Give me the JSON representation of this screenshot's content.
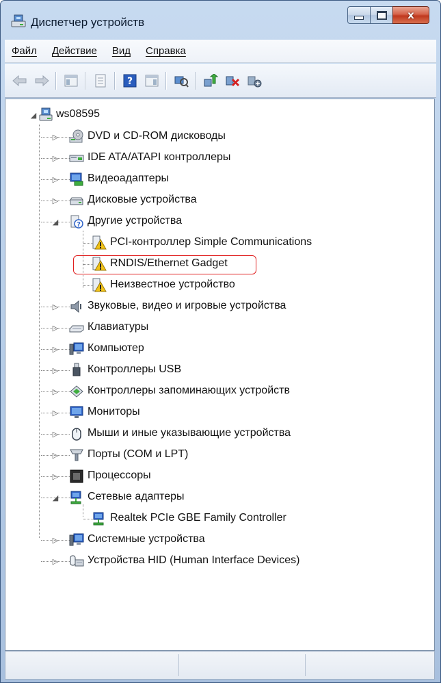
{
  "window": {
    "title": "Диспетчер устройств",
    "close_glyph": "x"
  },
  "menu": {
    "items": [
      "Файл",
      "Действие",
      "Вид",
      "Справка"
    ]
  },
  "toolbar": {
    "buttons": [
      "back-icon",
      "forward-icon",
      "properties-icon",
      "view-icon",
      "help-icon",
      "action-icon",
      "scan-hardware-icon",
      "update-driver-icon",
      "uninstall-icon",
      "disable-icon"
    ]
  },
  "tree": {
    "root": {
      "label": "ws08595",
      "icon": "computer-network-icon",
      "expanded": true
    },
    "nodes": [
      {
        "label": "DVD и CD-ROM дисководы",
        "icon": "dvd-icon",
        "expanded": false
      },
      {
        "label": "IDE ATA/ATAPI контроллеры",
        "icon": "ide-controller-icon",
        "expanded": false
      },
      {
        "label": "Видеоадаптеры",
        "icon": "display-adapter-icon",
        "expanded": false
      },
      {
        "label": "Дисковые устройства",
        "icon": "disk-drive-icon",
        "expanded": false
      },
      {
        "label": "Другие устройства",
        "icon": "other-devices-icon",
        "expanded": true,
        "children": [
          {
            "label": "PCI-контроллер Simple Communications",
            "icon": "unknown-device-warning-icon"
          },
          {
            "label": "RNDIS/Ethernet Gadget",
            "icon": "unknown-device-warning-icon",
            "highlighted": true
          },
          {
            "label": "Неизвестное устройство",
            "icon": "unknown-device-warning-icon"
          }
        ]
      },
      {
        "label": "Звуковые, видео и игровые устройства",
        "icon": "sound-icon",
        "expanded": false
      },
      {
        "label": "Клавиатуры",
        "icon": "keyboard-icon",
        "expanded": false
      },
      {
        "label": "Компьютер",
        "icon": "computer-icon",
        "expanded": false
      },
      {
        "label": "Контроллеры USB",
        "icon": "usb-icon",
        "expanded": false
      },
      {
        "label": "Контроллеры запоминающих устройств",
        "icon": "storage-controller-icon",
        "expanded": false
      },
      {
        "label": "Мониторы",
        "icon": "monitor-icon",
        "expanded": false
      },
      {
        "label": "Мыши и иные указывающие устройства",
        "icon": "mouse-icon",
        "expanded": false
      },
      {
        "label": "Порты (COM и LPT)",
        "icon": "port-icon",
        "expanded": false
      },
      {
        "label": "Процессоры",
        "icon": "processor-icon",
        "expanded": false
      },
      {
        "label": "Сетевые адаптеры",
        "icon": "network-adapter-icon",
        "expanded": true,
        "children": [
          {
            "label": "Realtek PCIe GBE Family Controller",
            "icon": "network-adapter-icon"
          }
        ]
      },
      {
        "label": "Системные устройства",
        "icon": "system-device-icon",
        "expanded": false
      },
      {
        "label": "Устройства HID (Human Interface Devices)",
        "icon": "hid-icon",
        "expanded": false
      }
    ]
  },
  "colors": {
    "title_bar": "#b8cde6",
    "highlight_border": "#e02020",
    "tree_background": "#ffffff"
  }
}
